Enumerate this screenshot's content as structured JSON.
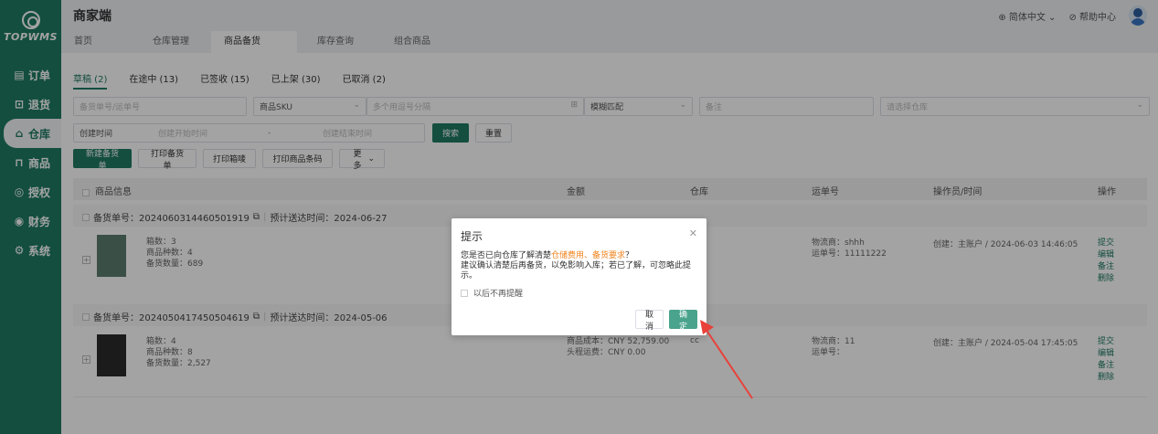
{
  "app": {
    "logo_text": "TOPWMS",
    "brand": "商家端"
  },
  "header": {
    "language": "简体中文",
    "help": "帮助中心"
  },
  "sidebar": {
    "items": [
      {
        "icon": "▤",
        "label": "订单"
      },
      {
        "icon": "⊡",
        "label": "退货"
      },
      {
        "icon": "⌂",
        "label": "仓库"
      },
      {
        "icon": "⊓",
        "label": "商品"
      },
      {
        "icon": "◎",
        "label": "授权"
      },
      {
        "icon": "◉",
        "label": "财务"
      },
      {
        "icon": "⚙",
        "label": "系统"
      }
    ]
  },
  "page_tabs": [
    "首页",
    "仓库管理",
    "商品备货",
    "库存查询",
    "组合商品"
  ],
  "status_tabs": [
    "草稿 (2)",
    "在途中 (13)",
    "已签收 (15)",
    "已上架 (30)",
    "已取消 (2)"
  ],
  "filters": {
    "order_no_placeholder": "备货单号/运单号",
    "sku_label": "商品SKU",
    "sku_placeholder": "多个用逗号分隔",
    "match_label": "模糊匹配",
    "remark_placeholder": "备注",
    "warehouse_placeholder": "请选择仓库",
    "created_label": "创建时间",
    "start_placeholder": "创建开始时间",
    "range_sep": "-",
    "end_placeholder": "创建结束时间",
    "search": "搜索",
    "reset": "重置"
  },
  "actions": {
    "new": "新建备货单",
    "print_order": "打印备货单",
    "print_box": "打印箱唛",
    "print_barcode": "打印商品条码",
    "more": "更多"
  },
  "table": {
    "headers": [
      "商品信息",
      "金额",
      "仓库",
      "运单号",
      "操作员/时间",
      "操作"
    ],
    "row_actions": [
      "提交",
      "编辑",
      "备注",
      "删除"
    ],
    "groups": [
      {
        "order_no": "备货单号：20240603144605019​19",
        "eta": "预计送达时间：2024-06-27",
        "boxes": "箱数：3",
        "sku_kinds": "商品种数：4",
        "qty": "备货数量：689",
        "carrier": "物流商：shhh",
        "tracking": "运单号：11111222",
        "operator": "创建：主账户 / 2024-06-03 14:46:05"
      },
      {
        "order_no": "备货单号：20240504174505046​19",
        "eta": "预计送达时间：2024-05-06",
        "boxes": "箱数：4",
        "sku_kinds": "商品种数：8",
        "qty": "备货数量：2,527",
        "cost": "商品成本：CNY 52,759.00",
        "freight": "头程运费：CNY 0.00",
        "warehouse": "cc",
        "carrier": "物流商：11",
        "tracking": "运单号：",
        "operator": "创建：主账户 / 2024-05-04 17:45:05"
      }
    ]
  },
  "modal": {
    "title": "提示",
    "line1_prefix": "您是否已向仓库了解清楚",
    "line1_highlight": "仓储费用、备货要求",
    "line1_suffix": "？",
    "line2": "建议确认清楚后再备货，以免影响入库；若已了解，可忽略此提示。",
    "remind": "以后不再提醒",
    "cancel": "取消",
    "ok": "确定"
  },
  "colors": {
    "brand": "#1f7a63",
    "highlight": "#f0831f",
    "annotation": "#e8413a"
  }
}
